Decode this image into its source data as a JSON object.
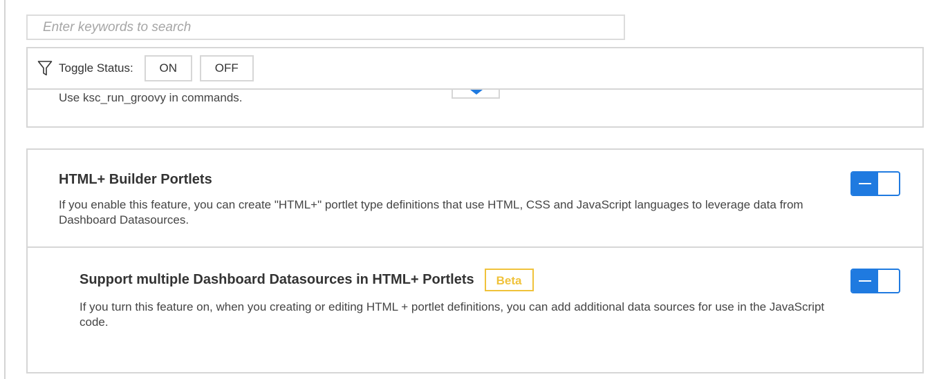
{
  "search": {
    "placeholder": "Enter keywords to search",
    "value": ""
  },
  "filter": {
    "icon": "funnel-icon",
    "label": "Toggle Status:",
    "on_label": "ON",
    "off_label": "OFF"
  },
  "previous_feature": {
    "description": "Use ksc_run_groovy in commands.",
    "dropdown_icon": "caret-down-icon"
  },
  "features": [
    {
      "title": "HTML+ Builder Portlets",
      "description": "If you enable this feature, you can create \"HTML+\" portlet type definitions that use HTML, CSS and JavaScript languages to leverage data from Dashboard Datasources.",
      "enabled": true
    },
    {
      "title": "Support multiple Dashboard Datasources in HTML+ Portlets",
      "badge": "Beta",
      "description": "If you turn this feature on, when you creating or editing HTML + portlet definitions, you can add additional data sources for use in the JavaScript code.",
      "enabled": true
    }
  ],
  "colors": {
    "accent": "#1f7ae0",
    "beta": "#f0c23a",
    "border": "#d6d6d6"
  }
}
